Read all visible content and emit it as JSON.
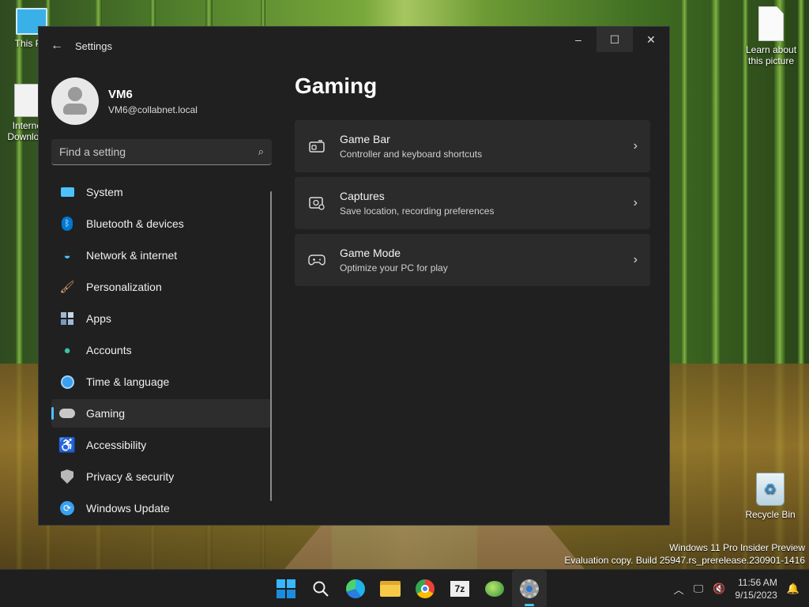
{
  "desktop": {
    "icons": [
      {
        "label": "This PC",
        "name": "this-pc"
      },
      {
        "label": "Internet Download Manager",
        "name": "idm"
      },
      {
        "label": "Learn about this picture",
        "name": "learn-picture"
      },
      {
        "label": "Recycle Bin",
        "name": "recycle-bin"
      }
    ],
    "watermark_line1": "Windows 11 Pro Insider Preview",
    "watermark_line2": "Evaluation copy. Build 25947.rs_prerelease.230901-1416"
  },
  "window": {
    "title": "Settings",
    "back_icon": "back-arrow-icon",
    "minimize": "–",
    "maximize": "☐",
    "close": "✕"
  },
  "profile": {
    "name": "VM6",
    "email": "VM6@collabnet.local"
  },
  "search": {
    "placeholder": "Find a setting"
  },
  "nav": [
    {
      "label": "System",
      "icon": "monitor-icon",
      "color": "#4cc2ff"
    },
    {
      "label": "Bluetooth & devices",
      "icon": "bluetooth-icon",
      "color": "#0078d4"
    },
    {
      "label": "Network & internet",
      "icon": "wifi-icon",
      "color": "#4cc2ff"
    },
    {
      "label": "Personalization",
      "icon": "brush-icon",
      "color": "#e8a87c"
    },
    {
      "label": "Apps",
      "icon": "apps-icon",
      "color": "#9fb8d6"
    },
    {
      "label": "Accounts",
      "icon": "person-icon",
      "color": "#36c4a4"
    },
    {
      "label": "Time & language",
      "icon": "globe-clock-icon",
      "color": "#3aa0f0"
    },
    {
      "label": "Gaming",
      "icon": "controller-icon",
      "color": "#c8c8c8",
      "active": true
    },
    {
      "label": "Accessibility",
      "icon": "accessibility-icon",
      "color": "#3aa0f0"
    },
    {
      "label": "Privacy & security",
      "icon": "shield-icon",
      "color": "#b8b8b8"
    },
    {
      "label": "Windows Update",
      "icon": "update-icon",
      "color": "#3aa0f0"
    }
  ],
  "page": {
    "title": "Gaming",
    "cards": [
      {
        "title": "Game Bar",
        "subtitle": "Controller and keyboard shortcuts",
        "icon": "game-bar-icon"
      },
      {
        "title": "Captures",
        "subtitle": "Save location, recording preferences",
        "icon": "capture-icon"
      },
      {
        "title": "Game Mode",
        "subtitle": "Optimize your PC for play",
        "icon": "game-mode-icon"
      }
    ]
  },
  "taskbar": {
    "apps": [
      "start-icon",
      "search-icon",
      "edge-icon",
      "file-explorer-icon",
      "chrome-icon",
      "7zip-icon",
      "network-app-icon",
      "settings-icon"
    ],
    "active_app": "settings-icon",
    "seven_zip_label": "7z",
    "time": "11:56 AM",
    "date": "9/15/2023"
  }
}
